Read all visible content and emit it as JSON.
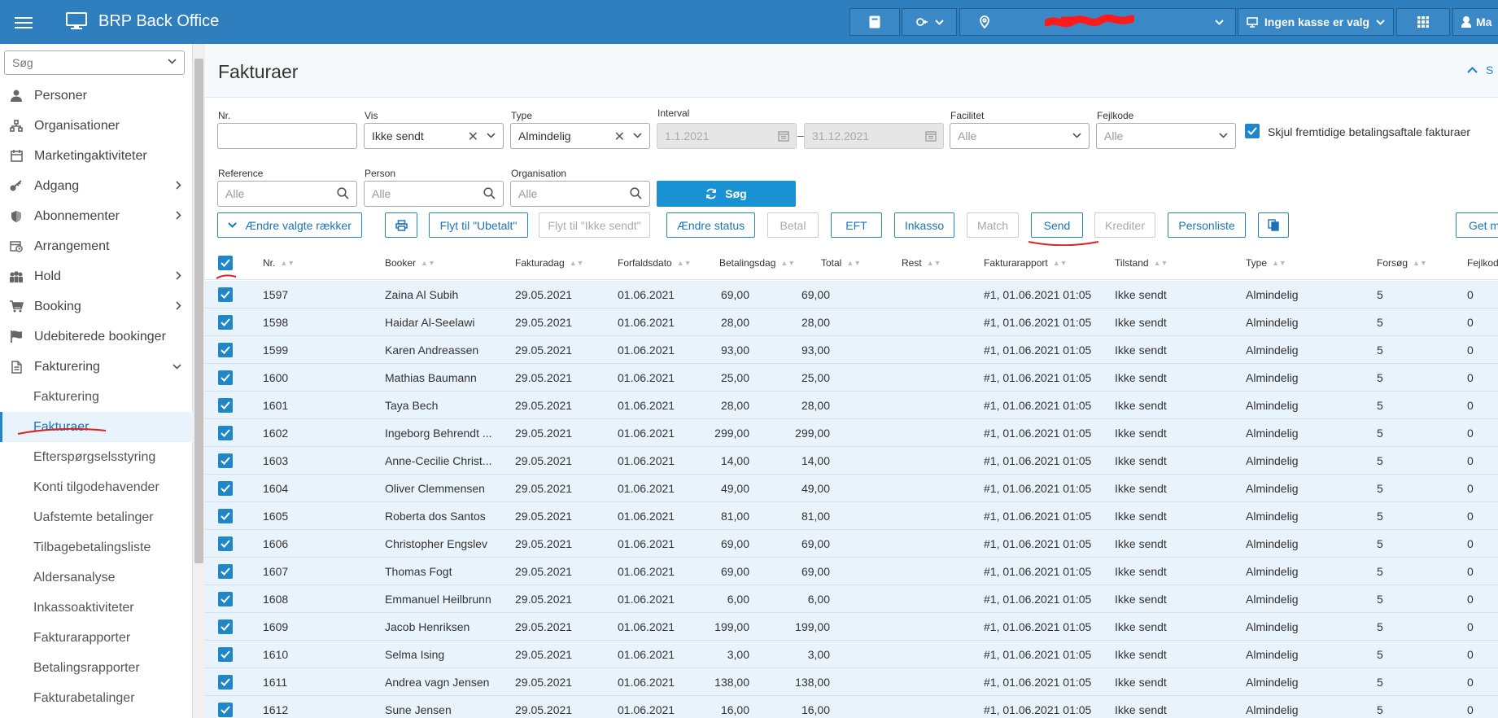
{
  "topbar": {
    "app_title": "BRP Back Office",
    "location_label": "",
    "register_label": "Ingen kasse er valg",
    "user_label": "Ma"
  },
  "sidebar": {
    "search_placeholder": "Søg",
    "items": [
      {
        "label": "Personer",
        "icon": "person-icon"
      },
      {
        "label": "Organisationer",
        "icon": "org-chart-icon"
      },
      {
        "label": "Marketingaktiviteter",
        "icon": "calendar-icon"
      },
      {
        "label": "Adgang",
        "icon": "key-icon"
      },
      {
        "label": "Abonnementer",
        "icon": "shield-icon"
      },
      {
        "label": "Arrangement",
        "icon": "calendar-clock-icon"
      },
      {
        "label": "Hold",
        "icon": "group-icon"
      },
      {
        "label": "Booking",
        "icon": "cart-icon"
      },
      {
        "label": "Udebiterede bookinger",
        "icon": "flag-icon"
      },
      {
        "label": "Fakturering",
        "icon": "document-icon"
      }
    ],
    "subitems": [
      "Fakturering",
      "Fakturaer",
      "Efterspørgselsstyring",
      "Konti tilgodehavender",
      "Uafstemte betalinger",
      "Tilbagebetalingsliste",
      "Aldersanalyse",
      "Inkassoaktiviteter",
      "Fakturarapporter",
      "Betalingsrapporter",
      "Fakturabetalinger"
    ]
  },
  "page": {
    "title": "Fakturaer",
    "collapse_label": "S"
  },
  "filters": {
    "nr_label": "Nr.",
    "nr_value": "",
    "vis_label": "Vis",
    "vis_value": "Ikke sendt",
    "type_label": "Type",
    "type_value": "Almindelig",
    "interval_label": "Interval",
    "interval_from": "1.1.2021",
    "interval_to": "31.12.2021",
    "facilitet_label": "Facilitet",
    "facilitet_value": "Alle",
    "fejlkode_label": "Fejlkode",
    "fejlkode_value": "Alle",
    "hide_future_label": "Skjul fremtidige betalingsaftale fakturaer",
    "reference_label": "Reference",
    "reference_placeholder": "Alle",
    "person_label": "Person",
    "person_placeholder": "Alle",
    "organisation_label": "Organisation",
    "organisation_placeholder": "Alle",
    "search_button": "Søg"
  },
  "actions": {
    "change_rows": "Ændre valgte rækker",
    "move_unpaid": "Flyt til \"Ubetalt\"",
    "move_not_sent": "Flyt til \"Ikke sendt\"",
    "change_status": "Ændre status",
    "pay": "Betal",
    "eft": "EFT",
    "collection": "Inkasso",
    "match": "Match",
    "send": "Send",
    "credit": "Krediter",
    "person_list": "Personliste",
    "get_more": "Get m"
  },
  "table": {
    "columns": [
      "Nr.",
      "Booker",
      "Fakturadag",
      "Forfaldsdato",
      "Betalingsdag",
      "Total",
      "Rest",
      "Fakturarapport",
      "Tilstand",
      "Type",
      "Forsøg",
      "Fejlkod"
    ],
    "rows": [
      {
        "nr": "1597",
        "booker": "Zaina Al Subih",
        "fakturadag": "29.05.2021",
        "forfald": "01.06.2021",
        "betalingsdag": "",
        "total": "69,00",
        "rest": "69,00",
        "rapport": "#1, 01.06.2021 01:05",
        "tilstand": "Ikke sendt",
        "type": "Almindelig",
        "forsog": "5",
        "fejlkode": "0"
      },
      {
        "nr": "1598",
        "booker": "Haidar Al-Seelawi",
        "fakturadag": "29.05.2021",
        "forfald": "01.06.2021",
        "betalingsdag": "",
        "total": "28,00",
        "rest": "28,00",
        "rapport": "#1, 01.06.2021 01:05",
        "tilstand": "Ikke sendt",
        "type": "Almindelig",
        "forsog": "5",
        "fejlkode": "0"
      },
      {
        "nr": "1599",
        "booker": "Karen Andreassen",
        "fakturadag": "29.05.2021",
        "forfald": "01.06.2021",
        "betalingsdag": "",
        "total": "93,00",
        "rest": "93,00",
        "rapport": "#1, 01.06.2021 01:05",
        "tilstand": "Ikke sendt",
        "type": "Almindelig",
        "forsog": "5",
        "fejlkode": "0"
      },
      {
        "nr": "1600",
        "booker": "Mathias Baumann",
        "fakturadag": "29.05.2021",
        "forfald": "01.06.2021",
        "betalingsdag": "",
        "total": "25,00",
        "rest": "25,00",
        "rapport": "#1, 01.06.2021 01:05",
        "tilstand": "Ikke sendt",
        "type": "Almindelig",
        "forsog": "5",
        "fejlkode": "0"
      },
      {
        "nr": "1601",
        "booker": "Taya Bech",
        "fakturadag": "29.05.2021",
        "forfald": "01.06.2021",
        "betalingsdag": "",
        "total": "28,00",
        "rest": "28,00",
        "rapport": "#1, 01.06.2021 01:05",
        "tilstand": "Ikke sendt",
        "type": "Almindelig",
        "forsog": "5",
        "fejlkode": "0"
      },
      {
        "nr": "1602",
        "booker": "Ingeborg Behrendt ...",
        "fakturadag": "29.05.2021",
        "forfald": "01.06.2021",
        "betalingsdag": "",
        "total": "299,00",
        "rest": "299,00",
        "rapport": "#1, 01.06.2021 01:05",
        "tilstand": "Ikke sendt",
        "type": "Almindelig",
        "forsog": "5",
        "fejlkode": "0"
      },
      {
        "nr": "1603",
        "booker": "Anne-Cecilie Christ...",
        "fakturadag": "29.05.2021",
        "forfald": "01.06.2021",
        "betalingsdag": "",
        "total": "14,00",
        "rest": "14,00",
        "rapport": "#1, 01.06.2021 01:05",
        "tilstand": "Ikke sendt",
        "type": "Almindelig",
        "forsog": "5",
        "fejlkode": "0"
      },
      {
        "nr": "1604",
        "booker": "Oliver Clemmensen",
        "fakturadag": "29.05.2021",
        "forfald": "01.06.2021",
        "betalingsdag": "",
        "total": "49,00",
        "rest": "49,00",
        "rapport": "#1, 01.06.2021 01:05",
        "tilstand": "Ikke sendt",
        "type": "Almindelig",
        "forsog": "5",
        "fejlkode": "0"
      },
      {
        "nr": "1605",
        "booker": "Roberta dos Santos",
        "fakturadag": "29.05.2021",
        "forfald": "01.06.2021",
        "betalingsdag": "",
        "total": "81,00",
        "rest": "81,00",
        "rapport": "#1, 01.06.2021 01:05",
        "tilstand": "Ikke sendt",
        "type": "Almindelig",
        "forsog": "5",
        "fejlkode": "0"
      },
      {
        "nr": "1606",
        "booker": "Christopher Engslev",
        "fakturadag": "29.05.2021",
        "forfald": "01.06.2021",
        "betalingsdag": "",
        "total": "69,00",
        "rest": "69,00",
        "rapport": "#1, 01.06.2021 01:05",
        "tilstand": "Ikke sendt",
        "type": "Almindelig",
        "forsog": "5",
        "fejlkode": "0"
      },
      {
        "nr": "1607",
        "booker": "Thomas Fogt",
        "fakturadag": "29.05.2021",
        "forfald": "01.06.2021",
        "betalingsdag": "",
        "total": "69,00",
        "rest": "69,00",
        "rapport": "#1, 01.06.2021 01:05",
        "tilstand": "Ikke sendt",
        "type": "Almindelig",
        "forsog": "5",
        "fejlkode": "0"
      },
      {
        "nr": "1608",
        "booker": "Emmanuel Heilbrunn",
        "fakturadag": "29.05.2021",
        "forfald": "01.06.2021",
        "betalingsdag": "",
        "total": "6,00",
        "rest": "6,00",
        "rapport": "#1, 01.06.2021 01:05",
        "tilstand": "Ikke sendt",
        "type": "Almindelig",
        "forsog": "5",
        "fejlkode": "0"
      },
      {
        "nr": "1609",
        "booker": "Jacob Henriksen",
        "fakturadag": "29.05.2021",
        "forfald": "01.06.2021",
        "betalingsdag": "",
        "total": "199,00",
        "rest": "199,00",
        "rapport": "#1, 01.06.2021 01:05",
        "tilstand": "Ikke sendt",
        "type": "Almindelig",
        "forsog": "5",
        "fejlkode": "0"
      },
      {
        "nr": "1610",
        "booker": "Selma Ising",
        "fakturadag": "29.05.2021",
        "forfald": "01.06.2021",
        "betalingsdag": "",
        "total": "3,00",
        "rest": "3,00",
        "rapport": "#1, 01.06.2021 01:05",
        "tilstand": "Ikke sendt",
        "type": "Almindelig",
        "forsog": "5",
        "fejlkode": "0"
      },
      {
        "nr": "1611",
        "booker": "Andrea vagn Jensen",
        "fakturadag": "29.05.2021",
        "forfald": "01.06.2021",
        "betalingsdag": "",
        "total": "138,00",
        "rest": "138,00",
        "rapport": "#1, 01.06.2021 01:05",
        "tilstand": "Ikke sendt",
        "type": "Almindelig",
        "forsog": "5",
        "fejlkode": "0"
      },
      {
        "nr": "1612",
        "booker": "Sune Jensen",
        "fakturadag": "29.05.2021",
        "forfald": "01.06.2021",
        "betalingsdag": "",
        "total": "16,00",
        "rest": "16,00",
        "rapport": "#1, 01.06.2021 01:05",
        "tilstand": "Ikke sendt",
        "type": "Almindelig",
        "forsog": "5",
        "fejlkode": "0"
      }
    ]
  },
  "colors": {
    "brand": "#2f7fbf",
    "accent": "#1f86c7",
    "row_selected": "#e9f3fb",
    "annotation": "#e0201c"
  }
}
